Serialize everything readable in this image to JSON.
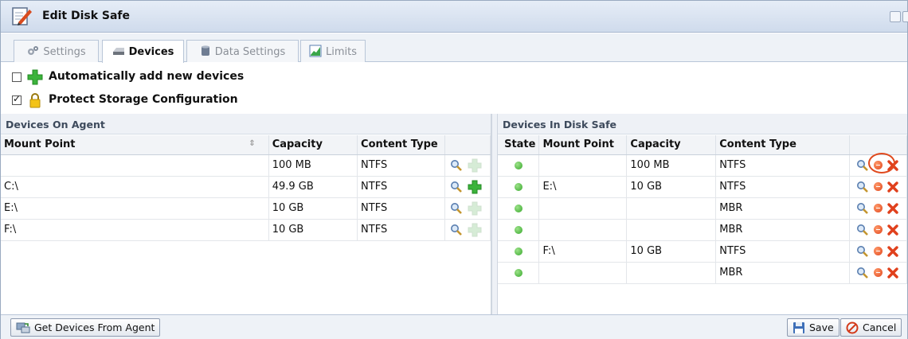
{
  "window": {
    "title": "Edit Disk Safe"
  },
  "tabs": [
    {
      "label": "Settings",
      "icon": "gears-icon",
      "active": false
    },
    {
      "label": "Devices",
      "icon": "disk-icon",
      "active": true
    },
    {
      "label": "Data Settings",
      "icon": "database-icon",
      "active": false
    },
    {
      "label": "Limits",
      "icon": "chart-icon",
      "active": false
    }
  ],
  "options": {
    "auto_add": {
      "label": "Automatically add new devices",
      "checked": false
    },
    "protect_storage": {
      "label": "Protect Storage Configuration",
      "checked": true
    }
  },
  "agent_panel": {
    "title": "Devices On Agent",
    "columns": [
      "Mount Point",
      "Capacity",
      "Content Type",
      ""
    ],
    "rows": [
      {
        "mount": "",
        "capacity": "100 MB",
        "type": "NTFS",
        "add_enabled": false
      },
      {
        "mount": "C:\\",
        "capacity": "49.9 GB",
        "type": "NTFS",
        "add_enabled": true
      },
      {
        "mount": "E:\\",
        "capacity": "10 GB",
        "type": "NTFS",
        "add_enabled": false
      },
      {
        "mount": "F:\\",
        "capacity": "10 GB",
        "type": "NTFS",
        "add_enabled": false
      }
    ]
  },
  "safe_panel": {
    "title": "Devices In Disk Safe",
    "columns": [
      "State",
      "Mount Point",
      "Capacity",
      "Content Type",
      ""
    ],
    "rows": [
      {
        "state": "ok",
        "mount": "",
        "capacity": "100 MB",
        "type": "NTFS"
      },
      {
        "state": "ok",
        "mount": "E:\\",
        "capacity": "10 GB",
        "type": "NTFS"
      },
      {
        "state": "ok",
        "mount": "",
        "capacity": "",
        "type": "MBR"
      },
      {
        "state": "ok",
        "mount": "",
        "capacity": "",
        "type": "MBR"
      },
      {
        "state": "ok",
        "mount": "F:\\",
        "capacity": "10 GB",
        "type": "NTFS"
      },
      {
        "state": "ok",
        "mount": "",
        "capacity": "",
        "type": "MBR"
      }
    ]
  },
  "footer": {
    "get_devices_label": "Get Devices From Agent",
    "save_label": "Save",
    "cancel_label": "Cancel"
  },
  "colors": {
    "accent": "#e04a1e",
    "ok": "#37a82b",
    "header_bg": "#cfdbec"
  }
}
